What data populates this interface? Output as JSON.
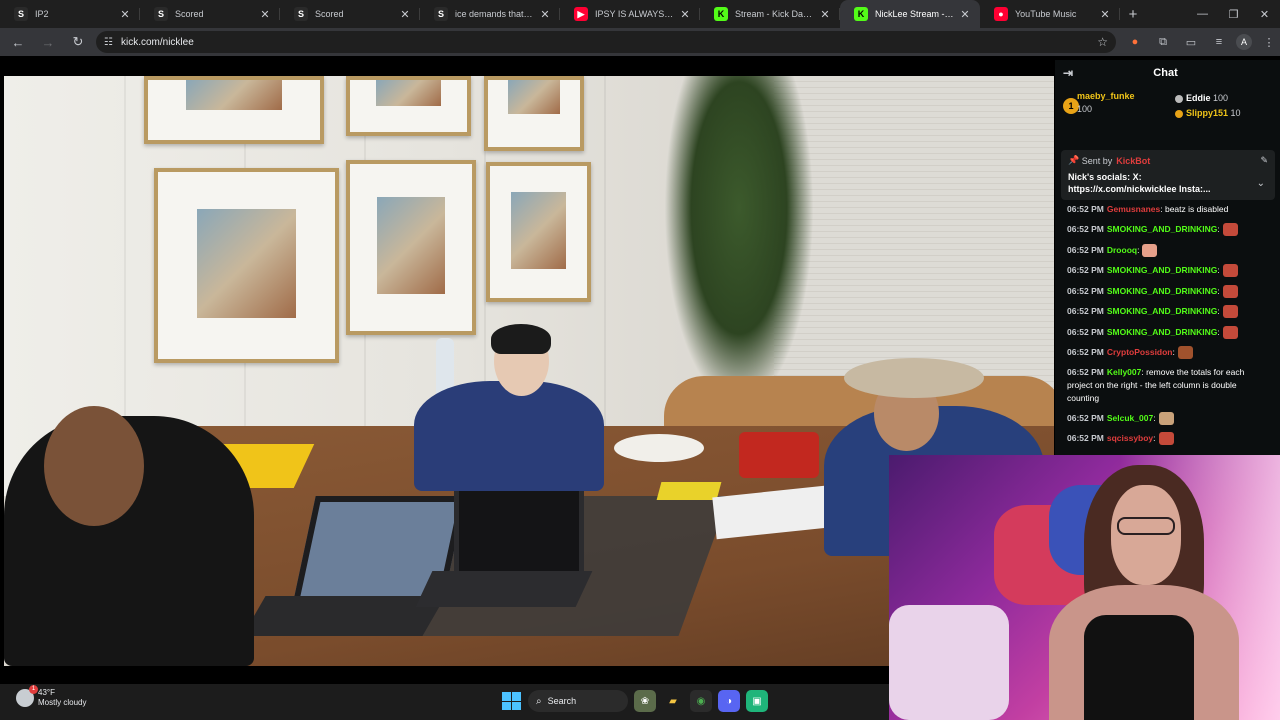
{
  "browser": {
    "tabs": [
      {
        "title": "IP2",
        "favicon": "S",
        "favicon_bg": "#2a2a2a",
        "favicon_color": "#ffffff",
        "active": false
      },
      {
        "title": "Scored",
        "favicon": "S",
        "favicon_bg": "#2a2a2a",
        "favicon_color": "#ffffff",
        "active": false
      },
      {
        "title": "Scored",
        "favicon": "S",
        "favicon_bg": "#2a2a2a",
        "favicon_color": "#ffffff",
        "active": false
      },
      {
        "title": "ice demands that cj read a",
        "favicon": "S",
        "favicon_bg": "#2a2a2a",
        "favicon_color": "#ffffff",
        "active": false
      },
      {
        "title": "IPSY IS ALWAYS A LITTLE S",
        "favicon": "▶",
        "favicon_bg": "#ff0033",
        "favicon_color": "#ffffff",
        "active": false
      },
      {
        "title": "Stream - Kick Dashboard",
        "favicon": "K",
        "favicon_bg": "#53fc18",
        "favicon_color": "#000000",
        "active": false
      },
      {
        "title": "NickLee Stream - Wat",
        "favicon": "K",
        "favicon_bg": "#53fc18",
        "favicon_color": "#000000",
        "active": true
      },
      {
        "title": "YouTube Music",
        "favicon": "●",
        "favicon_bg": "#ff0033",
        "favicon_color": "#ffffff",
        "active": false
      }
    ],
    "new_tab_icon": "+",
    "window_controls": {
      "minimize": "—",
      "restore": "❐",
      "close": "✕"
    },
    "address": {
      "url": "kick.com/nicklee"
    }
  },
  "chat": {
    "title": "Chat",
    "gifters": {
      "rank_badge": "1",
      "top": {
        "name": "maeby_funke",
        "count": "100"
      },
      "second": {
        "name": "Eddie",
        "count": "100"
      },
      "third": {
        "name": "Slippy151",
        "count": "10"
      }
    },
    "pinned": {
      "sent_by_label": "Sent by",
      "sender": "KickBot",
      "message": "Nick's socials: X: https://x.com/nickwicklee Insta:..."
    },
    "messages": [
      {
        "time": "06:52 PM",
        "user": "Gemusnanes",
        "color": "#e03d3d",
        "text": ": beatz is disabled",
        "emote": ""
      },
      {
        "time": "06:52 PM",
        "user": "SMOKING_AND_DRINKING",
        "color": "#53fc18",
        "text": ":",
        "emote": "#c44a3a"
      },
      {
        "time": "06:52 PM",
        "user": "Droooq",
        "color": "#53fc18",
        "text": ":",
        "emote": "#e6a08a"
      },
      {
        "time": "06:52 PM",
        "user": "SMOKING_AND_DRINKING",
        "color": "#53fc18",
        "text": ":",
        "emote": "#c44a3a"
      },
      {
        "time": "06:52 PM",
        "user": "SMOKING_AND_DRINKING",
        "color": "#53fc18",
        "text": ":",
        "emote": "#c44a3a"
      },
      {
        "time": "06:52 PM",
        "user": "SMOKING_AND_DRINKING",
        "color": "#53fc18",
        "text": ":",
        "emote": "#c44a3a"
      },
      {
        "time": "06:52 PM",
        "user": "SMOKING_AND_DRINKING",
        "color": "#53fc18",
        "text": ":",
        "emote": "#c44a3a"
      },
      {
        "time": "06:52 PM",
        "user": "CryptoPossidon",
        "color": "#e03d3d",
        "text": ":",
        "emote": "#a0522d"
      },
      {
        "time": "06:52 PM",
        "user": "Kelly007",
        "color": "#53fc18",
        "text": ": remove the totals for each project on the right - the left column is double counting",
        "emote": ""
      },
      {
        "time": "06:52 PM",
        "user": "Selcuk_007",
        "color": "#53fc18",
        "text": ":",
        "emote": "#c9a27a"
      },
      {
        "time": "06:52 PM",
        "user": "sqcissyboy",
        "color": "#e03d3d",
        "text": ":",
        "emote": "#c44a3a"
      }
    ]
  },
  "taskbar": {
    "weather": {
      "temp": "43°F",
      "condition": "Mostly cloudy",
      "badge": "1"
    },
    "search_label": "Search"
  }
}
